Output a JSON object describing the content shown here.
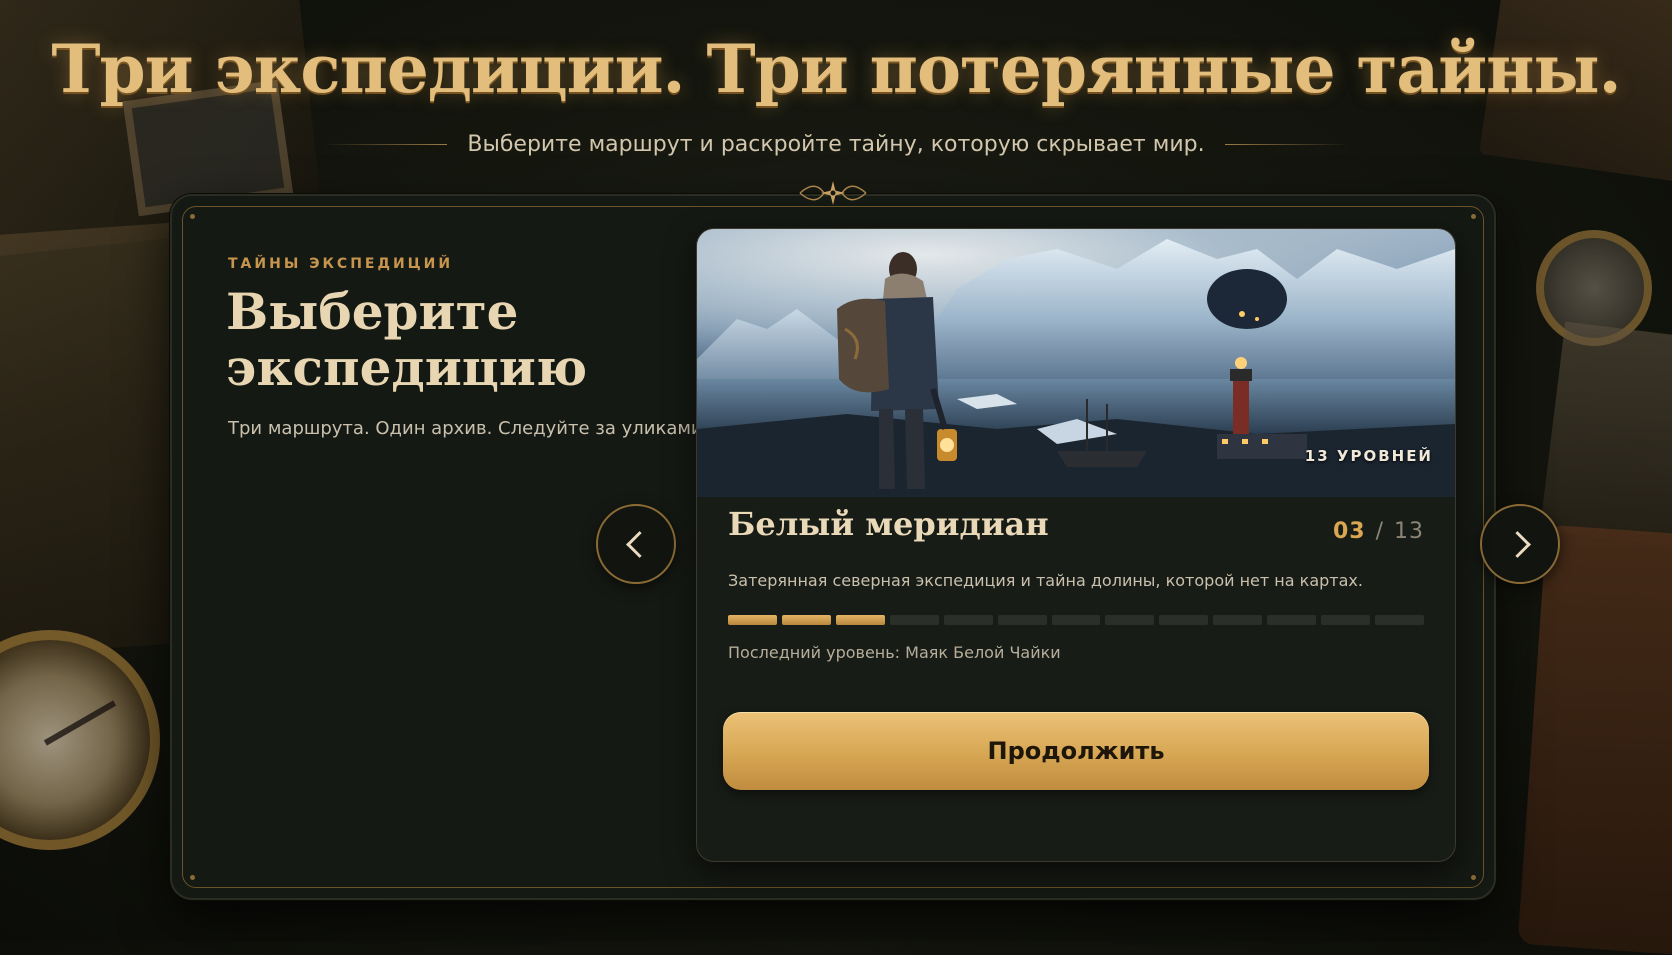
{
  "header": {
    "title": "Три экспедиции. Три потерянные тайны.",
    "subtitle": "Выберите маршрут и раскройте тайну, которую скрывает мир."
  },
  "left": {
    "eyebrow": "ТАЙНЫ ЭКСПЕДИЦИЙ",
    "title": "Выберите экспедицию",
    "subtitle": "Три маршрута. Один архив. Следуйте за уликами."
  },
  "card": {
    "levels_badge": "13 УРОВНЕЙ",
    "title": "Белый меридиан",
    "count_current": "03",
    "count_separator": "/",
    "count_total": "13",
    "description": "Затерянная северная экспедиция и тайна долины, которой нет на картах.",
    "progress": {
      "completed": 3,
      "total": 13
    },
    "last_level": "Последний уровень: Маяк Белой Чайки",
    "continue_label": "Продолжить"
  },
  "navigation": {
    "prev_icon": "chevron-left-icon",
    "next_icon": "chevron-right-icon"
  },
  "colors": {
    "accent_gold": "#d9a651",
    "button_gold": "#d6a653",
    "panel_bg": "#151913",
    "text_cream": "#e8d6b2"
  }
}
